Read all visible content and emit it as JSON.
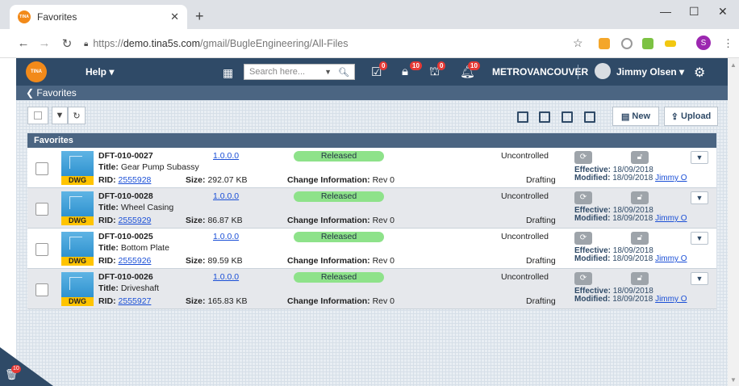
{
  "browser": {
    "tab_title": "Favorites",
    "favicon_text": "TINA",
    "url_prefix": "https://",
    "url_host": "demo.tina5s.com",
    "url_path": "/gmail/BugleEngineering/All-Files",
    "profile_letter": "S"
  },
  "app": {
    "logo_text": "TINA",
    "help_label": "Help ▾",
    "search_placeholder": "Search here...",
    "badges": {
      "checklist": "0",
      "lock": "10",
      "hierarchy": "0",
      "bell": "10"
    },
    "region": "METROVANCOUVER",
    "user_name": "Jimmy Olsen ▾",
    "breadcrumb": "Favorites",
    "new_label": "New",
    "upload_label": "Upload",
    "trash_badge": "10",
    "colors": {
      "nav": "#2f4a67",
      "released": "#8ee28a",
      "dwg_tag": "#ffc400",
      "badge": "#e53935"
    }
  },
  "panel": {
    "title": "Favorites",
    "rows": [
      {
        "number": "DFT-010-0027",
        "version": "1.0.0.0",
        "status": "Released",
        "control": "Uncontrolled",
        "title_label": "Title:",
        "title": "Gear Pump Subassy",
        "rid_label": "RID:",
        "rid": "2555928",
        "size_label": "Size:",
        "size": "292.07 KB",
        "change_label": "Change Information:",
        "change": "Rev 0",
        "stage": "Drafting",
        "effective_label": "Effective:",
        "effective": "18/09/2018",
        "modified_label": "Modified:",
        "modified": "18/09/2018",
        "modified_by": "Jimmy O",
        "type": "DWG"
      },
      {
        "number": "DFT-010-0028",
        "version": "1.0.0.0",
        "status": "Released",
        "control": "Uncontrolled",
        "title_label": "Title:",
        "title": "Wheel Casing",
        "rid_label": "RID:",
        "rid": "2555929",
        "size_label": "Size:",
        "size": "86.87 KB",
        "change_label": "Change Information:",
        "change": "Rev 0",
        "stage": "Drafting",
        "effective_label": "Effective:",
        "effective": "18/09/2018",
        "modified_label": "Modified:",
        "modified": "18/09/2018",
        "modified_by": "Jimmy O",
        "type": "DWG"
      },
      {
        "number": "DFT-010-0025",
        "version": "1.0.0.0",
        "status": "Released",
        "control": "Uncontrolled",
        "title_label": "Title:",
        "title": "Bottom Plate",
        "rid_label": "RID:",
        "rid": "2555926",
        "size_label": "Size:",
        "size": "89.59 KB",
        "change_label": "Change Information:",
        "change": "Rev 0",
        "stage": "Drafting",
        "effective_label": "Effective:",
        "effective": "18/09/2018",
        "modified_label": "Modified:",
        "modified": "18/09/2018",
        "modified_by": "Jimmy O",
        "type": "DWG"
      },
      {
        "number": "DFT-010-0026",
        "version": "1.0.0.0",
        "status": "Released",
        "control": "Uncontrolled",
        "title_label": "Title:",
        "title": "Driveshaft",
        "rid_label": "RID:",
        "rid": "2555927",
        "size_label": "Size:",
        "size": "165.83 KB",
        "change_label": "Change Information:",
        "change": "Rev 0",
        "stage": "Drafting",
        "effective_label": "Effective:",
        "effective": "18/09/2018",
        "modified_label": "Modified:",
        "modified": "18/09/2018",
        "modified_by": "Jimmy O",
        "type": "DWG"
      }
    ]
  }
}
